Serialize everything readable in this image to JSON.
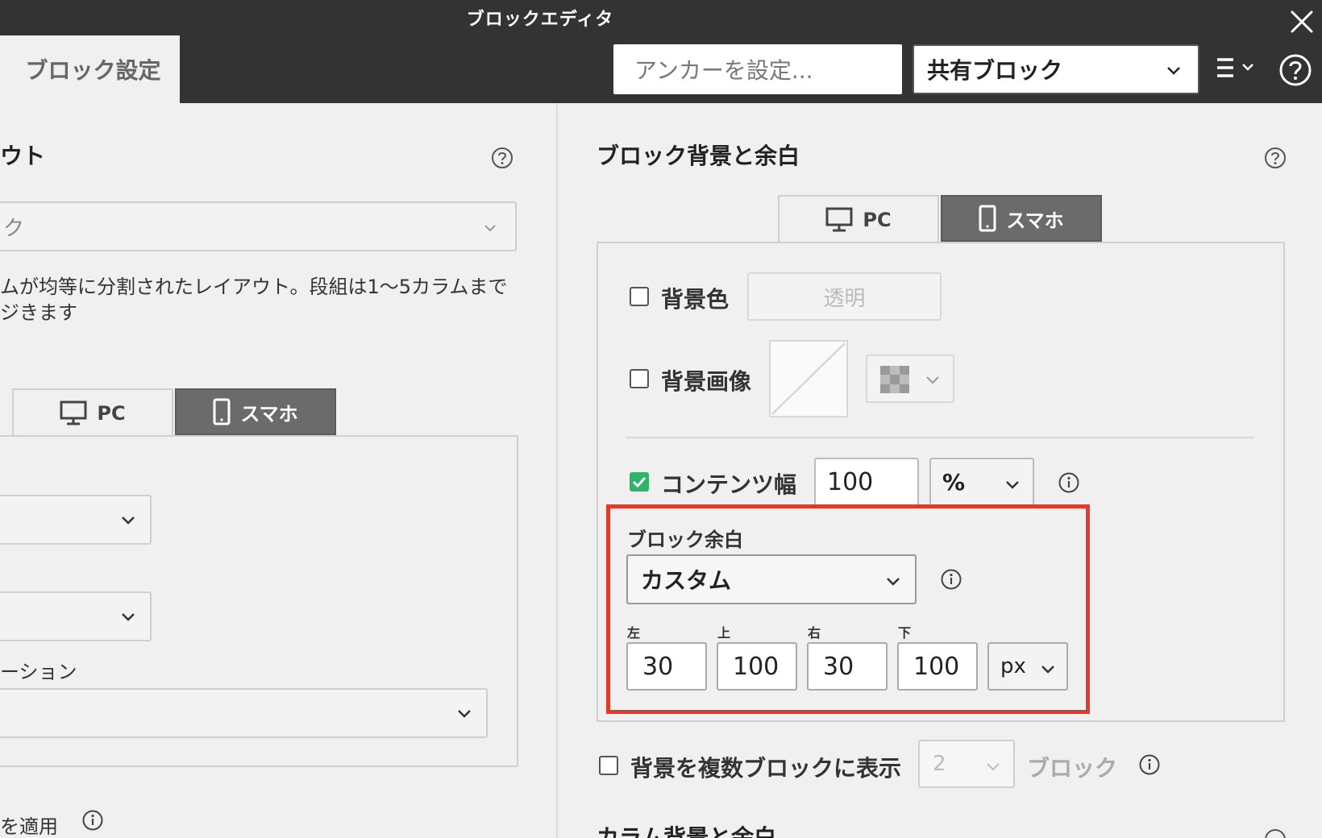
{
  "window": {
    "title": "ブロックエディタ"
  },
  "header": {
    "tab_label": "ブロック設定",
    "anchor_label": "アンカーを設定...",
    "shared_select_value": "共有ブロック"
  },
  "left": {
    "heading": "ウト",
    "layout_value": "ク",
    "description_line1": "ムが均等に分割されたレイアウト。段組は1〜5カラムまで",
    "description_line2": "ジきます",
    "tabs": [
      {
        "label": "PC"
      },
      {
        "label": "スマホ"
      }
    ],
    "field_label": "ーション",
    "apply_label": "を適用"
  },
  "right": {
    "heading": "ブロック背景と余白",
    "tabs": [
      {
        "label": "PC"
      },
      {
        "label": "スマホ"
      }
    ],
    "bg_color": {
      "label": "背景色",
      "checked": false,
      "value": "透明"
    },
    "bg_image": {
      "label": "背景画像",
      "checked": false
    },
    "content_width": {
      "label": "コンテンツ幅",
      "checked": true,
      "value": "100",
      "unit": "%"
    },
    "block_margin": {
      "label": "ブロック余白",
      "mode": "カスタム",
      "fields": [
        {
          "label": "左",
          "value": "30"
        },
        {
          "label": "上",
          "value": "100"
        },
        {
          "label": "右",
          "value": "30"
        },
        {
          "label": "下",
          "value": "100"
        }
      ],
      "unit": "px"
    },
    "multi_block": {
      "label": "背景を複数ブロックに表示",
      "checked": false,
      "count": "2",
      "suffix": "ブロック"
    },
    "next_heading": "カラム背景と余白"
  },
  "colors": {
    "titlebar": "#333333",
    "highlight": "#e03a2a",
    "checkbox_checked": "#2fb36b",
    "tab_inactive": "#6b6b6b"
  }
}
